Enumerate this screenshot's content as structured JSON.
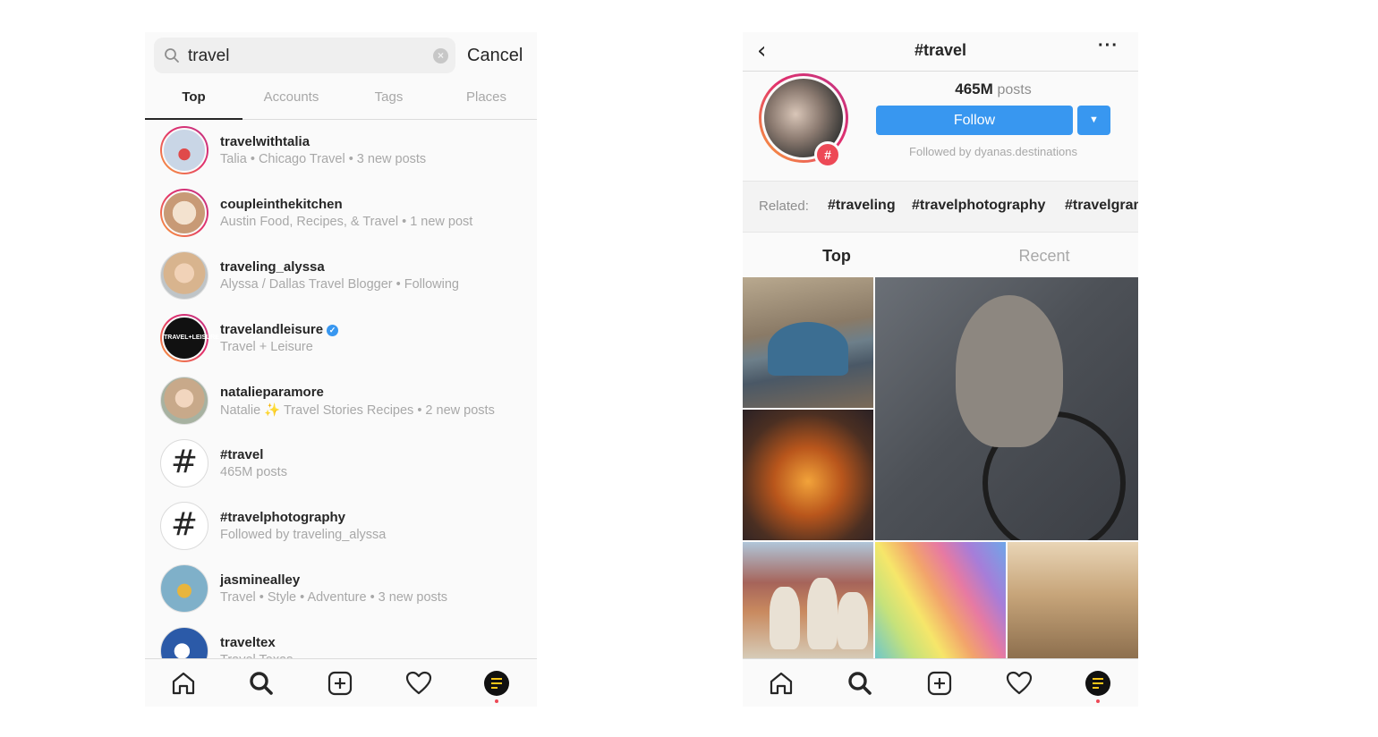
{
  "search_screen": {
    "query": "travel",
    "cancel_label": "Cancel",
    "tabs": [
      {
        "label": "Top",
        "active": true
      },
      {
        "label": "Accounts",
        "active": false
      },
      {
        "label": "Tags",
        "active": false
      },
      {
        "label": "Places",
        "active": false
      }
    ],
    "results": [
      {
        "name": "travelwithtalia",
        "sub": "Talia • Chicago Travel • 3 new posts",
        "type": "account",
        "story_ring": true,
        "color": "#c9d6e6"
      },
      {
        "name": "coupleinthekitchen",
        "sub": "Austin Food, Recipes, & Travel • 1 new post",
        "type": "account",
        "story_ring": true,
        "color": "#d9c0a8"
      },
      {
        "name": "traveling_alyssa",
        "sub": "Alyssa / Dallas Travel Blogger • Following",
        "type": "account",
        "story_ring": false,
        "color": "#d8b48e"
      },
      {
        "name": "travelandleisure",
        "sub": "Travel + Leisure",
        "type": "account",
        "story_ring": true,
        "verified": true,
        "color": "#111111"
      },
      {
        "name": "natalieparamore",
        "sub": "Natalie ✨ Travel Stories Recipes • 2 new posts",
        "type": "account",
        "story_ring": false,
        "color": "#c8a98a"
      },
      {
        "name": "#travel",
        "sub": "465M posts",
        "type": "hashtag"
      },
      {
        "name": "#travelphotography",
        "sub": "Followed by traveling_alyssa",
        "type": "hashtag"
      },
      {
        "name": "jasminealley",
        "sub": "Travel • Style • Adventure • 3 new posts",
        "type": "account",
        "story_ring": false,
        "color": "#7fb0c9"
      },
      {
        "name": "traveltex",
        "sub": "Travel Texas",
        "type": "account",
        "story_ring": false,
        "color": "#2b5aa8"
      }
    ]
  },
  "hashtag_screen": {
    "title": "#travel",
    "post_count": "465M",
    "post_count_label": "posts",
    "follow_label": "Follow",
    "followed_by": "Followed by dyanas.destinations",
    "related_label": "Related:",
    "related_tags": [
      "#traveling",
      "#travelphotography",
      "#travelgram"
    ],
    "tabs": [
      {
        "label": "Top",
        "active": true
      },
      {
        "label": "Recent",
        "active": false
      }
    ]
  },
  "tabbar_icons": [
    "home-icon",
    "search-icon",
    "add-post-icon",
    "heart-icon",
    "profile-avatar"
  ],
  "colors": {
    "accent_blue": "#3897f0",
    "badge_red": "#ed4956",
    "text_primary": "#262626",
    "text_secondary": "#a8a8a8"
  }
}
